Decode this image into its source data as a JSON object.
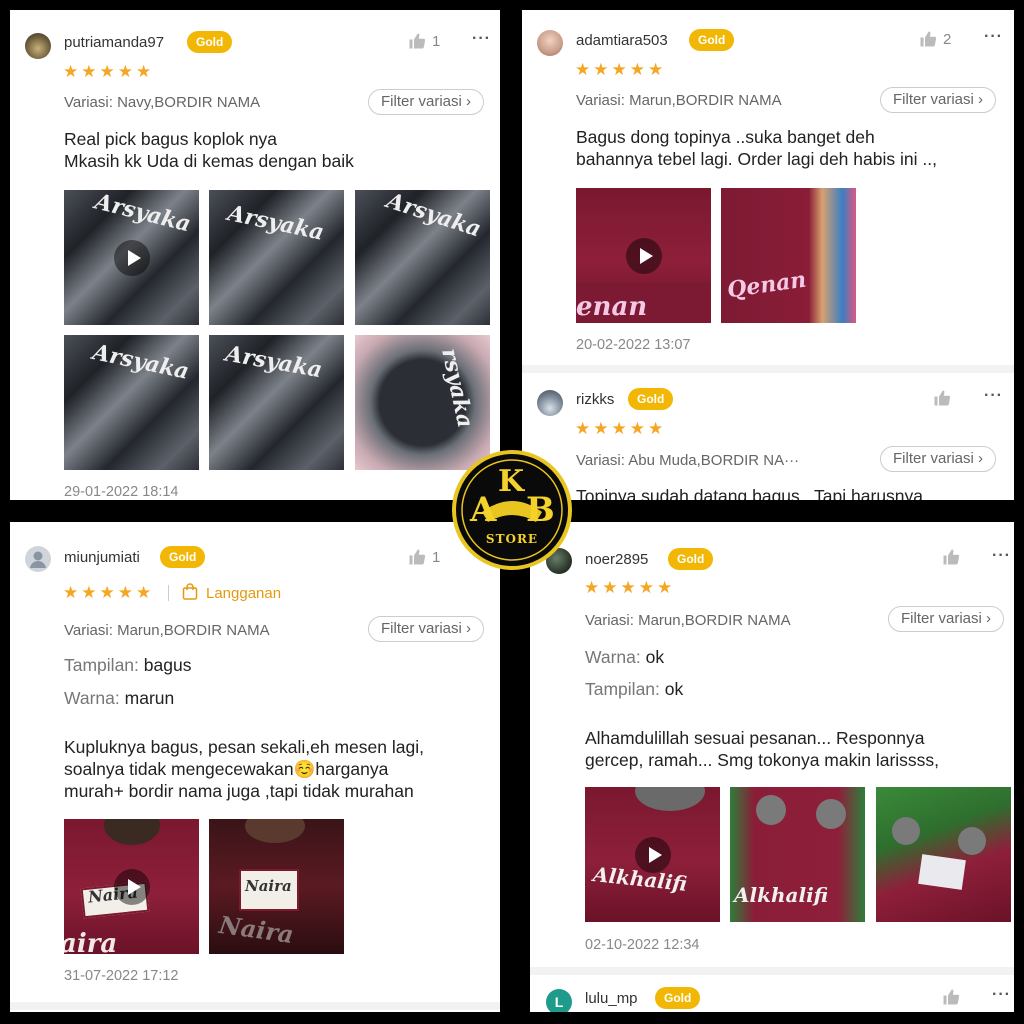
{
  "logo": {
    "letters_top": "K",
    "letters_left": "A",
    "letters_right": "B",
    "sub": "STORE"
  },
  "colors": {
    "gold_badge": "#f2b705",
    "star": "#f5a623",
    "accent_orange": "#e49a10"
  },
  "icons": {
    "like": "thumbs-up-icon",
    "more": "more-dots-icon",
    "play": "play-icon",
    "bag": "shopping-bag-icon",
    "star": "star-icon",
    "chevron": "chevron-right-icon"
  },
  "panel_tl": {
    "user": "putriamanda97",
    "badge": "Gold",
    "likes": "1",
    "more": "···",
    "stars": 5,
    "variasi": "Variasi: Navy,BORDIR NAMA",
    "filter": "Filter variasi",
    "text": "Real pick bagus koplok nya\nMkasih kk Uda di kemas dengan baik",
    "embroidery": [
      "Arsyaka",
      "Arsyaka",
      "Arsyaka",
      "Arsyaka",
      "Arsyaka",
      "rsyaka"
    ],
    "date": "29-01-2022 18:14"
  },
  "panel_tr": {
    "r1": {
      "user": "adamtiara503",
      "badge": "Gold",
      "likes": "2",
      "more": "···",
      "stars": 5,
      "variasi": "Variasi: Marun,BORDIR NAMA",
      "filter": "Filter variasi",
      "text": "Bagus dong topinya ..suka banget deh\nbahannya tebel lagi. Order lagi deh habis ini ..,",
      "embroidery": [
        "enan",
        "Qenan"
      ],
      "date": "20-02-2022 13:07"
    },
    "r2": {
      "user": "rizkks",
      "badge": "Gold",
      "more": "···",
      "stars": 5,
      "variasi": "Variasi: Abu Muda,BORDIR NA···",
      "filter": "Filter variasi",
      "text": "Topinya sudah datang bagus.. Tapi harusnya"
    }
  },
  "panel_bl": {
    "user": "miunjumiati",
    "badge": "Gold",
    "likes": "1",
    "more": "···",
    "stars": 5,
    "langganan": "Langganan",
    "variasi": "Variasi: Marun,BORDIR NAMA",
    "filter": "Filter variasi",
    "tampilan_k": "Tampilan:",
    "tampilan_v": "bagus",
    "warna_k": "Warna:",
    "warna_v": "marun",
    "text": "Kupluknya bagus, pesan sekali,eh mesen lagi,\nsoalnya tidak mengecewakan☺️harganya\nmurah+ bordir nama juga ,tapi tidak murahan",
    "embroidery": [
      "Naira",
      "Naira",
      "aira",
      "Naira"
    ],
    "date": "31-07-2022 17:12"
  },
  "panel_br": {
    "r1": {
      "user": "noer2895",
      "badge": "Gold",
      "more": "···",
      "stars": 5,
      "variasi": "Variasi: Marun,BORDIR NAMA",
      "filter": "Filter variasi",
      "warna_k": "Warna:",
      "warna_v": "ok",
      "tampilan_k": "Tampilan:",
      "tampilan_v": "ok",
      "text": "Alhamdulillah sesuai pesanan... Responnya\ngercep, ramah... Smg tokonya makin larissss,",
      "embroidery": [
        "Alkhalifi",
        "Alkhalifi"
      ],
      "date": "02-10-2022 12:34"
    },
    "r2": {
      "user": "lulu_mp",
      "badge": "Gold",
      "avatar_letter": "L",
      "more": "···"
    }
  }
}
